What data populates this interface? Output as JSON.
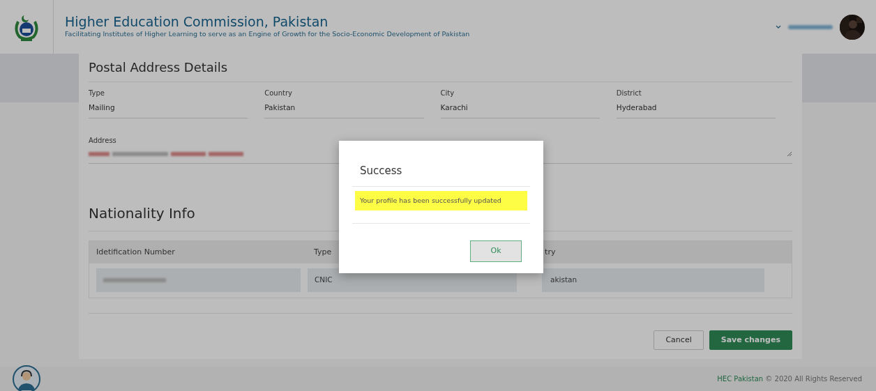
{
  "header": {
    "title": "Higher Education Commission, Pakistan",
    "tagline": "Facilitating Institutes of Higher Learning to serve as an Engine of Growth for the Socio-Economic Development of Pakistan"
  },
  "postal_address": {
    "heading": "Postal Address Details",
    "fields": [
      {
        "label": "Type",
        "value": "Mailing"
      },
      {
        "label": "Country",
        "value": "Pakistan"
      },
      {
        "label": "City",
        "value": "Karachi"
      },
      {
        "label": "District",
        "value": "Hyderabad"
      }
    ],
    "address_label": "Address"
  },
  "nationality": {
    "heading": "Nationality Info",
    "columns": [
      "Idetification Number",
      "Type",
      "try"
    ],
    "row": {
      "type": "CNIC",
      "column_3": "akistan"
    }
  },
  "actions": [
    {
      "label": "Cancel",
      "kind": "secondary"
    },
    {
      "label": "Save changes",
      "kind": "primary"
    }
  ],
  "dialog": {
    "title": "Success",
    "message": "Your profile has been successfully updated",
    "button": "Ok"
  },
  "footer": {
    "brand": "HEC Pakistan",
    "text": "© 2020 All Rights Reserved"
  }
}
